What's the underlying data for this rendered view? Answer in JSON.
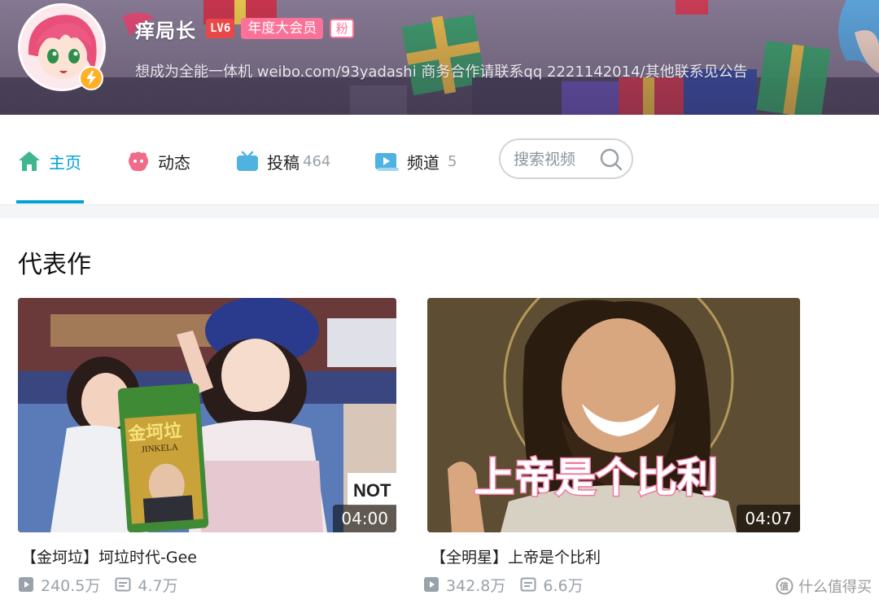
{
  "profile": {
    "name": "痒局长",
    "level": "LV6",
    "vip": "年度大会员",
    "fan_badge": "粉",
    "signature": "想成为全能一体机 weibo.com/93yadashi 商务合作请联系qq 2221142014/其他联系见公告"
  },
  "nav": {
    "tabs": [
      {
        "label": "主页",
        "count": "",
        "icon": "home-icon",
        "active": true
      },
      {
        "label": "动态",
        "count": "",
        "icon": "dynamic-icon"
      },
      {
        "label": "投稿",
        "count": "464",
        "icon": "tv-icon"
      },
      {
        "label": "频道",
        "count": "5",
        "icon": "channel-icon"
      }
    ],
    "search_placeholder": "搜索视频"
  },
  "section": {
    "title": "代表作",
    "videos": [
      {
        "title": "【金坷垃】坷垃时代-Gee",
        "duration": "04:00",
        "plays": "240.5万",
        "danmaku": "4.7万",
        "thumb_text": "金坷垃",
        "thumb_subtext": "JINKELA",
        "thumb_text_2": "NOT"
      },
      {
        "title": "【全明星】上帝是个比利",
        "duration": "04:07",
        "plays": "342.8万",
        "danmaku": "6.6万",
        "thumb_text": "上帝是个比利"
      }
    ]
  },
  "watermark": "什么值得买",
  "colors": {
    "accent": "#00a1d6",
    "pink": "#fb7299",
    "level_red": "#e94848",
    "home_green": "#3eb78c",
    "dynamic_pink": "#f06a8a",
    "tv_blue": "#4fb2e1"
  }
}
